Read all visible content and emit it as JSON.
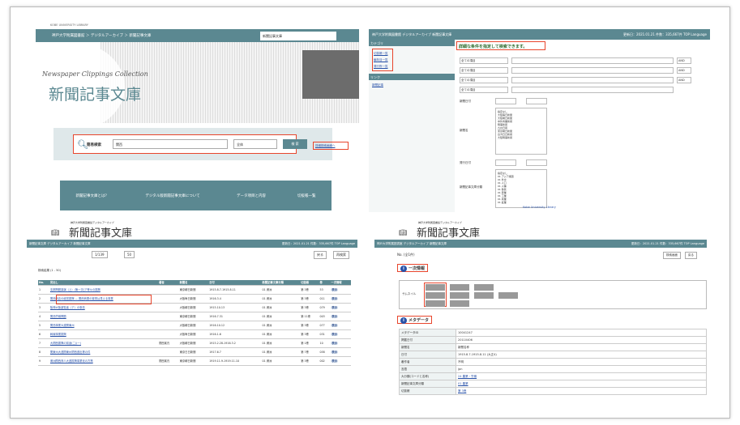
{
  "q1": {
    "top_text": "KOBE UNIVERSITY LIBRARY",
    "breadcrumb": "神戸大学附属図書館 ＞ デジタルアーカイブ ＞ 新聞記事文庫",
    "select": "新聞記事文庫",
    "logo_en": "Newspaper Clippings Collection",
    "logo_jp": "新聞記事文庫",
    "search_label": "簡易検索",
    "search_value": "関西",
    "category": "全体",
    "search_button": "検 索",
    "advanced": "詳細検索画面へ",
    "nav": [
      "新聞記事文庫とは？",
      "デジタル版新聞記事文庫について",
      "データ項目と内容",
      "切抜帳一覧"
    ]
  },
  "q2": {
    "breadcrumb": "神戸大学附属図書館 デジタルアーカイブ 新聞記事文庫",
    "topright": "更新日：2021.01.21 件数：335,667件 TOP Language",
    "side_head": "カテゴリ",
    "side_items": [
      "切抜帳一覧",
      "編年目一覧",
      "発行所一覧"
    ],
    "side_head2": "リンク",
    "side_link": "新聞記事",
    "heading": "詳細な条件を指定して検索できます。",
    "rows": [
      "全ての項目",
      "全ての項目",
      "全ての項目",
      "全ての項目"
    ],
    "op": "AND",
    "labels": [
      "新聞日付",
      "新聞名",
      "発行日付",
      "新聞記事文庫分類"
    ],
    "papers": "指定なし\n大阪毎日新聞\n大阪朝日新聞\n中外商業新報\n時事新報\n九州日報\n東京朝日新聞\n台湾日日新報\n大阪時事新報",
    "classes": "指定なし\n01 アジア諸国\n01 外交\n01 人口\n01 人種\n01 移民\n01 農業\n01 工業\n01 商業\n01 鉱業",
    "footer": "Kobe University Library"
  },
  "q3": {
    "logo_small": "神戸大学附属図書館デジタルアーカイブ",
    "logo": "新聞記事文庫",
    "bar_left": "新聞記事文庫 デジタルアーカイブ 新聞記事文庫",
    "bar_right": "更新日：2021.01.21 件数：335,667件 TOP Language",
    "pager": "1/139",
    "per": "50",
    "back": "戻る",
    "research": "再検索",
    "count": "検索結果 (1 - 50)",
    "headers": [
      "No.",
      "見出し",
      "著者",
      "新聞名",
      "日付",
      "新聞記事文庫分類",
      "切抜帳",
      "巻",
      "一次情報"
    ],
    "rows": [
      [
        "1",
        "支那問題講演（上）(第一次)ア等々の振興",
        "",
        "東京朝日新聞",
        "1915.8.7-1915.8.11",
        "01 満洲",
        "第 3巻",
        "53",
        "表示"
      ],
      [
        "2",
        "関西商店の経営振興 — 関西商業の繁栄は見える事業",
        "",
        "大阪毎日新聞",
        "1916.3.4",
        "01 満洲",
        "第 3巻",
        "011",
        "表示"
      ],
      [
        "3",
        "阪神大阪遊覧者（ア）の事情",
        "",
        "大阪朝日新聞",
        "1915.10.13",
        "01 満洲",
        "第 3巻",
        "079",
        "表示"
      ],
      [
        "4",
        "関西労働問題",
        "",
        "東京朝日新聞",
        "1916.7.31",
        "01 満洲",
        "第 11巻",
        "003",
        "表示"
      ],
      [
        "5",
        "関西事業大連関東州",
        "",
        "大阪朝日新聞",
        "1916.10.12",
        "01 満洲",
        "第 3巻",
        "077",
        "表示"
      ],
      [
        "6",
        "幹線事業振興",
        "",
        "大阪毎日新聞",
        "1916.1.6",
        "01 満洲",
        "第 3巻",
        "031",
        "表示"
      ],
      [
        "7",
        "大関西振興の前途(二)(一)",
        "関西某氏",
        "大阪朝日新聞",
        "1915.2.28-1916.3.2",
        "01 満洲",
        "第 1巻",
        "10",
        "表示"
      ],
      [
        "8",
        "関東州大連関東州関西進出等の件",
        "",
        "東京日日新聞",
        "1917.6.7",
        "01 満洲",
        "第 7巻",
        "058",
        "表示"
      ],
      [
        "9",
        "満洲関西商人大連振興事業化の方策",
        "関西某氏",
        "東京朝日新聞",
        "1919.11.9-1919.11.10",
        "01 満洲",
        "第 3巻",
        "002",
        "表示"
      ]
    ]
  },
  "q4": {
    "logo_small": "神戸大学附属図書館デジタルアーカイブ",
    "logo": "新聞記事文庫",
    "bar_left": "神戸大学附属図書館 デジタルアーカイブ 新聞記事文庫",
    "bar_right": "更新日：2021.01.21 件数：335,667件 TOP Language",
    "no": "No. (全1件)",
    "btns": [
      "検索画面",
      "戻る"
    ],
    "sec1": "一次情報",
    "thumb_label": "サムネイル",
    "sec2": "メタデータ",
    "meta": [
      [
        "メタデータID",
        "10041247"
      ],
      [
        "掲載日付",
        "20110406"
      ],
      [
        "新聞名",
        "新聞名称"
      ],
      [
        "日付",
        "1915.8.7-1915.8.11 (大正4)"
      ],
      [
        "著作者",
        "不明"
      ],
      [
        "言語",
        "jpn"
      ],
      [
        "大分類(コードと名称)",
        "24 農業・労働"
      ],
      [
        "新聞記事文庫分類",
        "01 農業"
      ],
      [
        "切抜帳",
        "第 3巻"
      ]
    ]
  }
}
